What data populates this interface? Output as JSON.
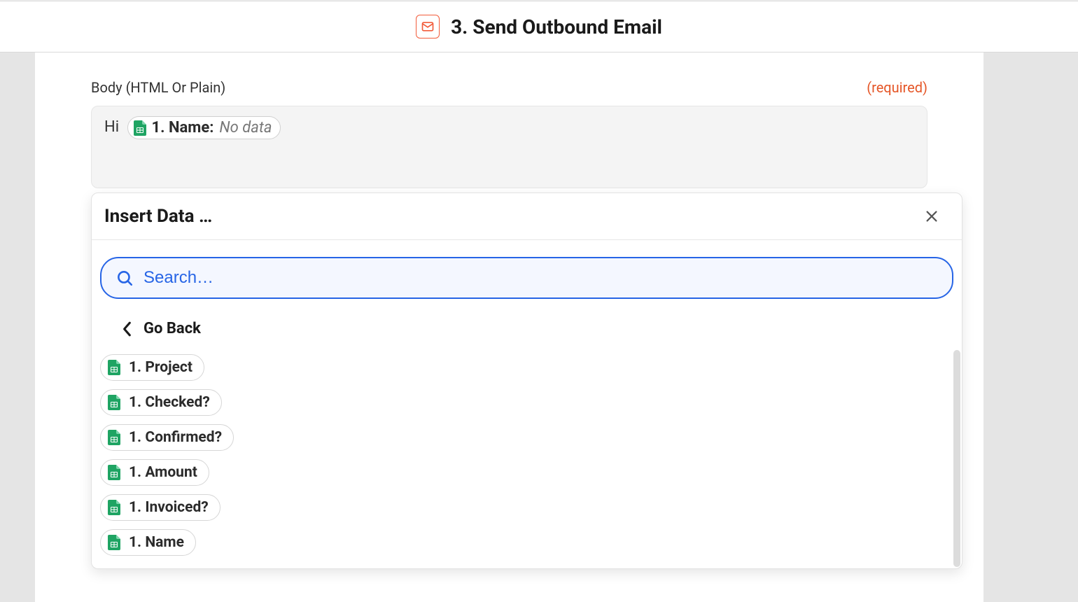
{
  "header": {
    "title": "3. Send Outbound Email"
  },
  "field": {
    "label": "Body (HTML Or Plain)",
    "required_label": "(required)",
    "prefix": "Hi",
    "pill": {
      "label": "1. Name:",
      "value": "No data"
    }
  },
  "popover": {
    "title": "Insert Data …",
    "search_placeholder": "Search…",
    "go_back": "Go Back",
    "items": [
      {
        "label": "1. Project"
      },
      {
        "label": "1. Checked?"
      },
      {
        "label": "1. Confirmed?"
      },
      {
        "label": "1. Amount"
      },
      {
        "label": "1. Invoiced?"
      },
      {
        "label": "1. Name"
      }
    ]
  }
}
